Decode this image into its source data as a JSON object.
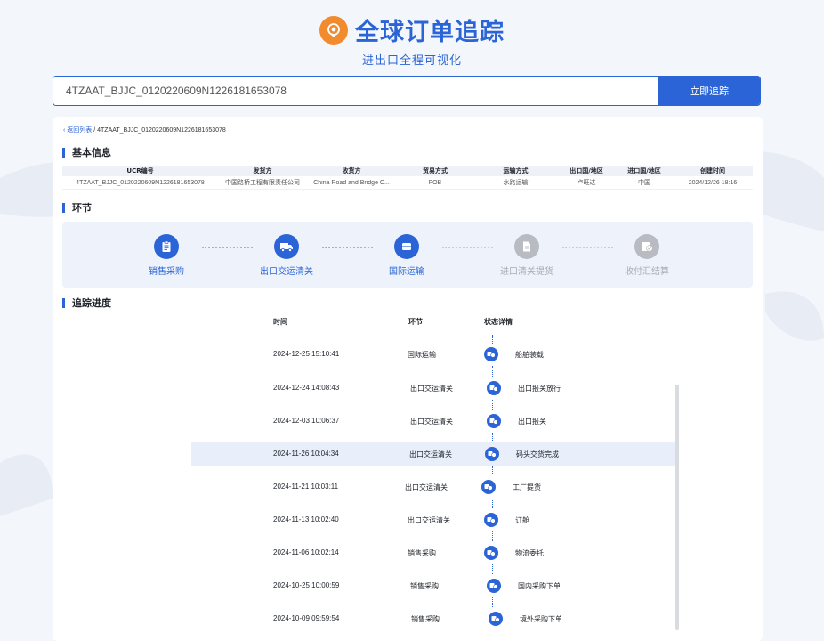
{
  "header": {
    "title": "全球订单追踪",
    "subtitle": "进出口全程可视化"
  },
  "search": {
    "value": "4TZAAT_BJJC_0120220609N1226181653078",
    "button_label": "立即追踪"
  },
  "breadcrumb": {
    "back_label": "返回列表",
    "separator": "/",
    "current": "4TZAAT_BJJC_0120220609N1226181653078"
  },
  "basic_info": {
    "title": "基本信息",
    "columns": [
      "UCR编号",
      "发货方",
      "收货方",
      "贸易方式",
      "运输方式",
      "出口国/地区",
      "进口国/地区",
      "创建时间"
    ],
    "row": [
      "4TZAAT_BJJC_0120220609N1226181653078",
      "中国路桥工程有限责任公司",
      "China Road and Bridge C...",
      "FOB",
      "水路运输",
      "卢旺达",
      "中国",
      "2024/12/26 18:16"
    ]
  },
  "stages": {
    "title": "环节",
    "items": [
      {
        "label": "销售采购",
        "status": "active",
        "icon": "clipboard-icon"
      },
      {
        "label": "出口交运清关",
        "status": "active",
        "icon": "truck-icon"
      },
      {
        "label": "国际运输",
        "status": "active",
        "icon": "ship-icon"
      },
      {
        "label": "进口清关提货",
        "status": "inactive",
        "icon": "document-icon"
      },
      {
        "label": "收付汇结算",
        "status": "inactive",
        "icon": "payment-check-icon"
      }
    ]
  },
  "tracking": {
    "title": "追踪进度",
    "columns": {
      "time": "时间",
      "stage": "环节",
      "status": "状态详情"
    },
    "rows": [
      {
        "time": "2024-12-25 15:10:41",
        "stage": "国际运输",
        "status": "船舶装载"
      },
      {
        "time": "2024-12-24 14:08:43",
        "stage": "出口交运清关",
        "status": "出口报关放行"
      },
      {
        "time": "2024-12-03 10:06:37",
        "stage": "出口交运清关",
        "status": "出口报关"
      },
      {
        "time": "2024-11-26 10:04:34",
        "stage": "出口交运清关",
        "status": "码头交货完成"
      },
      {
        "time": "2024-11-21 10:03:11",
        "stage": "出口交运清关",
        "status": "工厂提货"
      },
      {
        "time": "2024-11-13 10:02:40",
        "stage": "出口交运清关",
        "status": "订舱"
      },
      {
        "time": "2024-11-06 10:02:14",
        "stage": "销售采购",
        "status": "物流委托"
      },
      {
        "time": "2024-10-25 10:00:59",
        "stage": "销售采购",
        "status": "国内采购下单"
      },
      {
        "time": "2024-10-09 09:59:54",
        "stage": "销售采购",
        "status": "境外采购下单"
      }
    ]
  },
  "colors": {
    "accent": "#2a64d6",
    "logo": "#f28a2e",
    "inactive": "#b8bcc2"
  }
}
